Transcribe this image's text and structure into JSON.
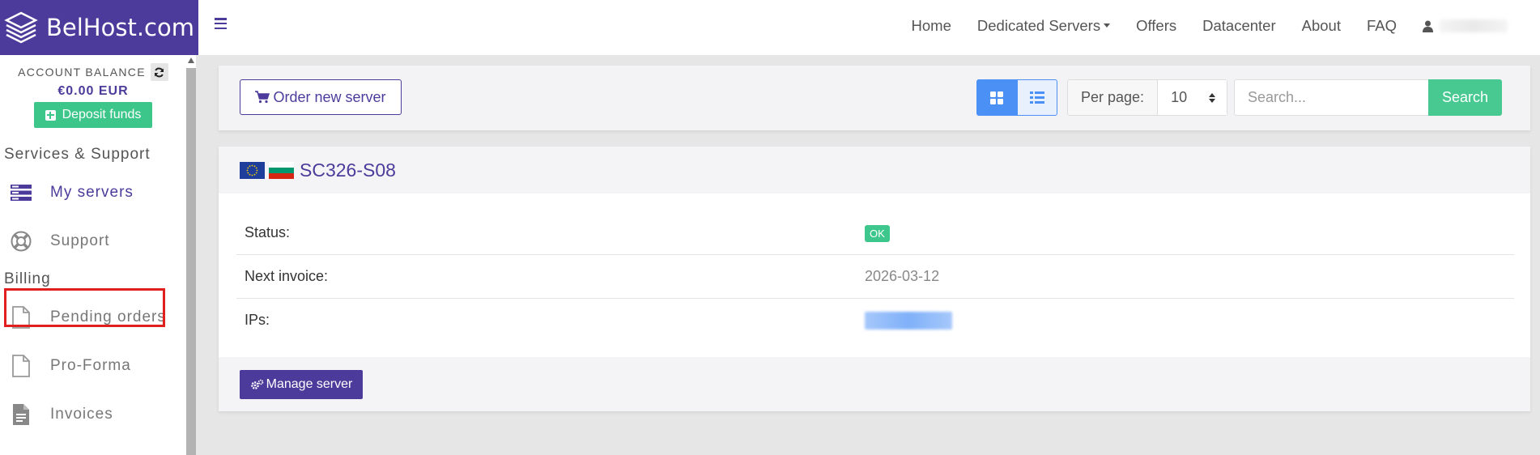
{
  "brand": {
    "name": "BelHost.com",
    "color": "#4d3b9b"
  },
  "nav": {
    "items": [
      "Home",
      "Dedicated Servers",
      "Offers",
      "Datacenter",
      "About",
      "FAQ"
    ],
    "user_icon": "user-icon"
  },
  "sidebar": {
    "balance_label": "ACCOUNT BALANCE",
    "balance_amount": "€0.00 EUR",
    "deposit_label": "Deposit funds",
    "sections": [
      {
        "title": "Services & Support",
        "items": [
          {
            "label": "My servers",
            "icon": "servers-icon"
          },
          {
            "label": "Support",
            "icon": "lifebuoy-icon"
          }
        ]
      },
      {
        "title": "Billing",
        "items": [
          {
            "label": "Pending orders",
            "icon": "document-icon"
          },
          {
            "label": "Pro-Forma",
            "icon": "document-icon"
          },
          {
            "label": "Invoices",
            "icon": "invoice-icon"
          }
        ]
      }
    ]
  },
  "toolbar": {
    "order_label": "Order new server",
    "per_page_label": "Per page:",
    "per_page_value": "10",
    "search_placeholder": "Search...",
    "search_label": "Search"
  },
  "server": {
    "name": "SC326-S08",
    "flags": [
      "eu-flag-icon",
      "bg-flag-icon"
    ],
    "rows": [
      {
        "label": "Status:",
        "value": "OK"
      },
      {
        "label": "Next invoice:",
        "value": "2026-03-12"
      },
      {
        "label": "IPs:",
        "value": ""
      }
    ],
    "manage_label": "Manage server"
  },
  "colors": {
    "accent": "#4d3b9b",
    "success": "#47c991",
    "primary": "#4a90f5",
    "highlight": "#e0201e"
  }
}
